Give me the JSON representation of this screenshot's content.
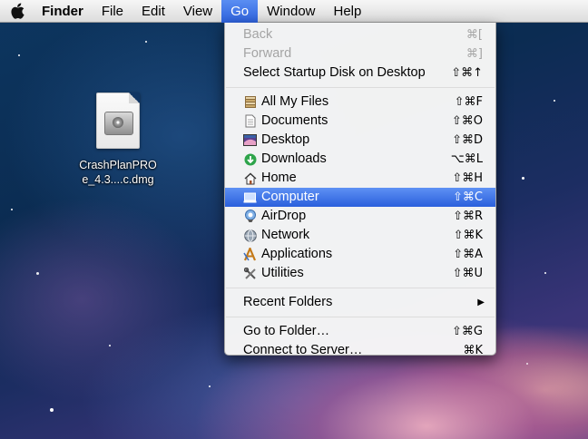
{
  "menubar": {
    "apple_icon": "apple-logo-icon",
    "app_name": "Finder",
    "menus": [
      "File",
      "Edit",
      "View",
      "Go",
      "Window",
      "Help"
    ],
    "active_menu": "Go"
  },
  "desktop": {
    "icon_label_line1": "CrashPlanPRO",
    "icon_label_line2": "e_4.3....c.dmg"
  },
  "go_menu": {
    "back": {
      "label": "Back",
      "shortcut": "⌘["
    },
    "forward": {
      "label": "Forward",
      "shortcut": "⌘]"
    },
    "startup": {
      "label": "Select Startup Disk on Desktop",
      "shortcut": "⇧⌘↑"
    },
    "places": [
      {
        "label": "All My Files",
        "shortcut": "⇧⌘F",
        "icon": "all-my-files-icon"
      },
      {
        "label": "Documents",
        "shortcut": "⇧⌘O",
        "icon": "documents-icon"
      },
      {
        "label": "Desktop",
        "shortcut": "⇧⌘D",
        "icon": "desktop-icon"
      },
      {
        "label": "Downloads",
        "shortcut": "⌥⌘L",
        "icon": "downloads-icon"
      },
      {
        "label": "Home",
        "shortcut": "⇧⌘H",
        "icon": "home-icon"
      },
      {
        "label": "Computer",
        "shortcut": "⇧⌘C",
        "icon": "computer-icon"
      },
      {
        "label": "AirDrop",
        "shortcut": "⇧⌘R",
        "icon": "airdrop-icon"
      },
      {
        "label": "Network",
        "shortcut": "⇧⌘K",
        "icon": "network-icon"
      },
      {
        "label": "Applications",
        "shortcut": "⇧⌘A",
        "icon": "applications-icon"
      },
      {
        "label": "Utilities",
        "shortcut": "⇧⌘U",
        "icon": "utilities-icon"
      }
    ],
    "recent_folders": {
      "label": "Recent Folders",
      "arrow": "▶"
    },
    "go_to_folder": {
      "label": "Go to Folder…",
      "shortcut": "⇧⌘G"
    },
    "connect": {
      "label": "Connect to Server…",
      "shortcut": "⌘K"
    }
  },
  "colors": {
    "highlight": "#2e62dd",
    "disabled_text": "#a4a4a4"
  }
}
